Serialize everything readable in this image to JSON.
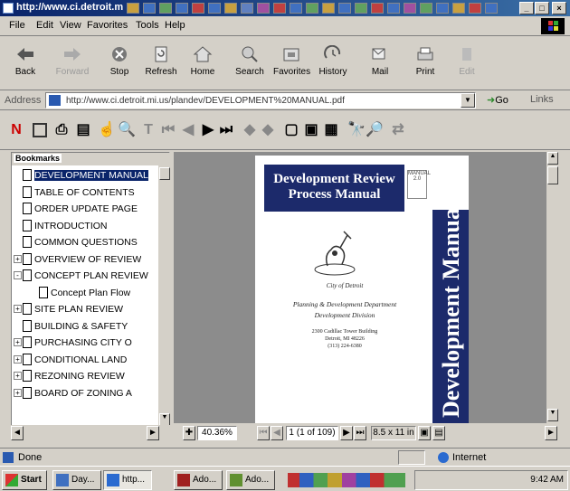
{
  "window": {
    "title": "http://www.ci.detroit.mi.us",
    "controls": [
      "_",
      "□",
      "×"
    ]
  },
  "menu": [
    "File",
    "Edit",
    "View",
    "Favorites",
    "Tools",
    "Help"
  ],
  "toolbar": [
    {
      "label": "Back",
      "icon": "back-arrow-icon",
      "enabled": true
    },
    {
      "label": "Forward",
      "icon": "forward-arrow-icon",
      "enabled": false
    },
    {
      "label": "Stop",
      "icon": "stop-icon",
      "enabled": true
    },
    {
      "label": "Refresh",
      "icon": "refresh-icon",
      "enabled": true
    },
    {
      "label": "Home",
      "icon": "home-icon",
      "enabled": true
    },
    {
      "label": "Search",
      "icon": "search-icon",
      "enabled": true
    },
    {
      "label": "Favorites",
      "icon": "favorites-icon",
      "enabled": true
    },
    {
      "label": "History",
      "icon": "history-icon",
      "enabled": true
    },
    {
      "label": "Mail",
      "icon": "mail-icon",
      "enabled": true
    },
    {
      "label": "Print",
      "icon": "print-icon",
      "enabled": true
    },
    {
      "label": "Edit",
      "icon": "edit-icon",
      "enabled": false
    }
  ],
  "address": {
    "label": "Address",
    "url": "http://www.ci.detroit.mi.us/plandev/DEVELOPMENT%20MANUAL.pdf",
    "go": "Go",
    "links": "Links"
  },
  "bookmarks": {
    "tab_label": "Bookmarks",
    "items": [
      {
        "label": "DEVELOPMENT MANUAL",
        "expander": "",
        "indent": 0,
        "selected": true
      },
      {
        "label": "TABLE OF CONTENTS",
        "expander": "",
        "indent": 0,
        "selected": false
      },
      {
        "label": "ORDER UPDATE PAGE",
        "expander": "",
        "indent": 0,
        "selected": false
      },
      {
        "label": "INTRODUCTION",
        "expander": "",
        "indent": 0,
        "selected": false
      },
      {
        "label": "COMMON QUESTIONS",
        "expander": "",
        "indent": 0,
        "selected": false
      },
      {
        "label": "OVERVIEW OF REVIEW",
        "expander": "+",
        "indent": 0,
        "selected": false
      },
      {
        "label": "CONCEPT PLAN REVIEW",
        "expander": "-",
        "indent": 0,
        "selected": false
      },
      {
        "label": "Concept Plan Flow",
        "expander": "",
        "indent": 1,
        "selected": false
      },
      {
        "label": "SITE PLAN REVIEW",
        "expander": "+",
        "indent": 0,
        "selected": false
      },
      {
        "label": "BUILDING & SAFETY",
        "expander": "",
        "indent": 0,
        "selected": false
      },
      {
        "label": "PURCHASING CITY O",
        "expander": "+",
        "indent": 0,
        "selected": false
      },
      {
        "label": "CONDITIONAL LAND",
        "expander": "+",
        "indent": 0,
        "selected": false
      },
      {
        "label": "REZONING REVIEW",
        "expander": "+",
        "indent": 0,
        "selected": false
      },
      {
        "label": "BOARD OF ZONING A",
        "expander": "+",
        "indent": 0,
        "selected": false
      }
    ]
  },
  "document": {
    "cover_title": "Development Review Process Manual",
    "side_text": "Development Manual",
    "city_caption": "City of Detroit",
    "dept": "Planning & Development Department",
    "division": "Development Division",
    "address_lines": [
      "2300 Cadillac Tower Building",
      "Detroit, MI 48226",
      "(313) 224-6380"
    ],
    "manual_tag": "MANUAL 2.0"
  },
  "doc_status": {
    "zoom": "40.36%",
    "page": "1 (1 of 109)",
    "page_size": "8.5 x 11 in"
  },
  "status": {
    "text": "Done",
    "zone": "Internet"
  },
  "taskbar": {
    "start": "Start",
    "tasks": [
      "Day...",
      "http...",
      "Ado...",
      "Ado..."
    ],
    "clock": "9:42 AM"
  },
  "colors": {
    "titlebar": "#0a246a",
    "cover_blue": "#1c2a6b",
    "selection": "#0a246a"
  }
}
